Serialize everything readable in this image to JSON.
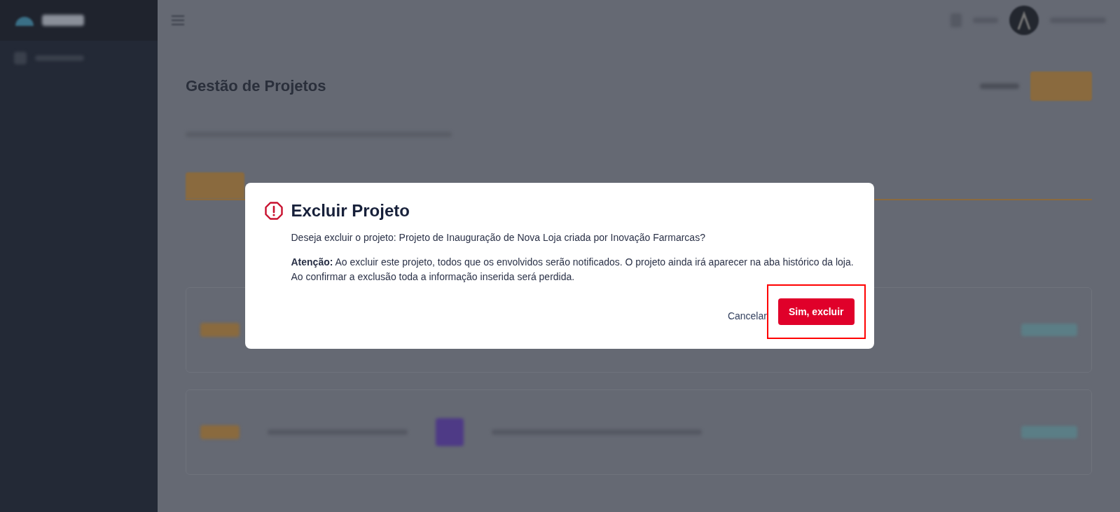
{
  "page": {
    "title": "Gestão de Projetos"
  },
  "dialog": {
    "title": "Excluir Projeto",
    "question": "Deseja excluir o projeto: Projeto de Inauguração de Nova Loja criada por Inovação Farmarcas?",
    "warning": "**Atenção:** Ao excluir este projeto, todos que os envolvidos serão notificados. O projeto ainda irá aparecer na aba histórico da loja. Ao confirmar a exclusão toda a informação inserida será perdida.",
    "buttons": [
      {
        "kind": "text",
        "label": "Cancelar",
        "highlighted": false
      },
      {
        "kind": "danger",
        "label": "Sim, excluir",
        "highlighted": true
      }
    ]
  }
}
